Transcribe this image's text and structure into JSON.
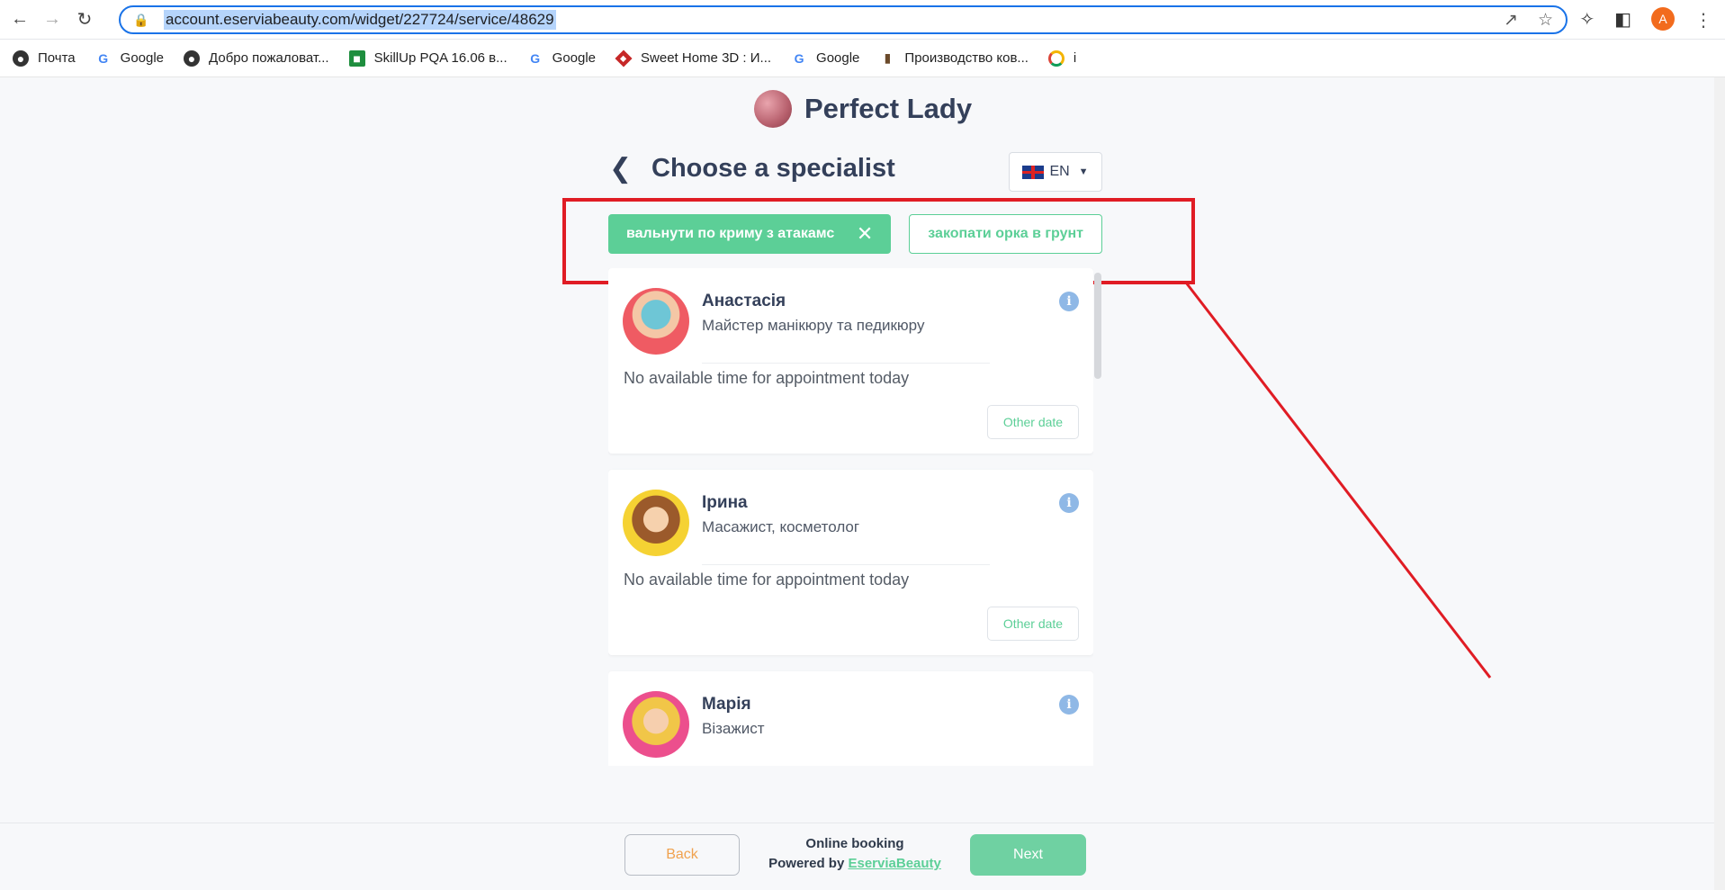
{
  "browser": {
    "url": "account.eserviabeauty.com/widget/227724/service/48629",
    "profile_initial": "A",
    "bookmarks": [
      {
        "label": "Почта",
        "icon": "globe-icon"
      },
      {
        "label": "Google",
        "icon": "google-icon"
      },
      {
        "label": "Добро пожаловат...",
        "icon": "globe-icon"
      },
      {
        "label": "SkillUp PQA 16.06 в...",
        "icon": "classroom-icon"
      },
      {
        "label": "Google",
        "icon": "google-icon"
      },
      {
        "label": "Sweet Home 3D : И...",
        "icon": "cube-icon"
      },
      {
        "label": "Google",
        "icon": "google-icon"
      },
      {
        "label": "Производство ков...",
        "icon": "book-icon"
      },
      {
        "label": "i",
        "icon": "ring-icon"
      }
    ]
  },
  "brand": {
    "name": "Perfect Lady"
  },
  "header": {
    "title": "Choose a specialist",
    "language": "EN"
  },
  "chips": [
    {
      "label": "вальнути по криму з атакамс",
      "active": true
    },
    {
      "label": "закопати орка в грунт",
      "active": false
    }
  ],
  "specialists": [
    {
      "name": "Анастасія",
      "role": "Майстер манікюру та педикюру",
      "status": "No available time for appointment today",
      "action": "Other date"
    },
    {
      "name": "Ірина",
      "role": "Масажист, косметолог",
      "status": "No available time for appointment today",
      "action": "Other date"
    },
    {
      "name": "Марія",
      "role": "Візажист"
    }
  ],
  "footer": {
    "back": "Back",
    "online": "Online booking",
    "powered_prefix": "Powered by",
    "powered_link": "EserviaBeauty",
    "next": "Next"
  },
  "colors": {
    "accent_green": "#5ccf97",
    "annotation_red": "#e01c24",
    "back_text": "#f0a24e"
  }
}
